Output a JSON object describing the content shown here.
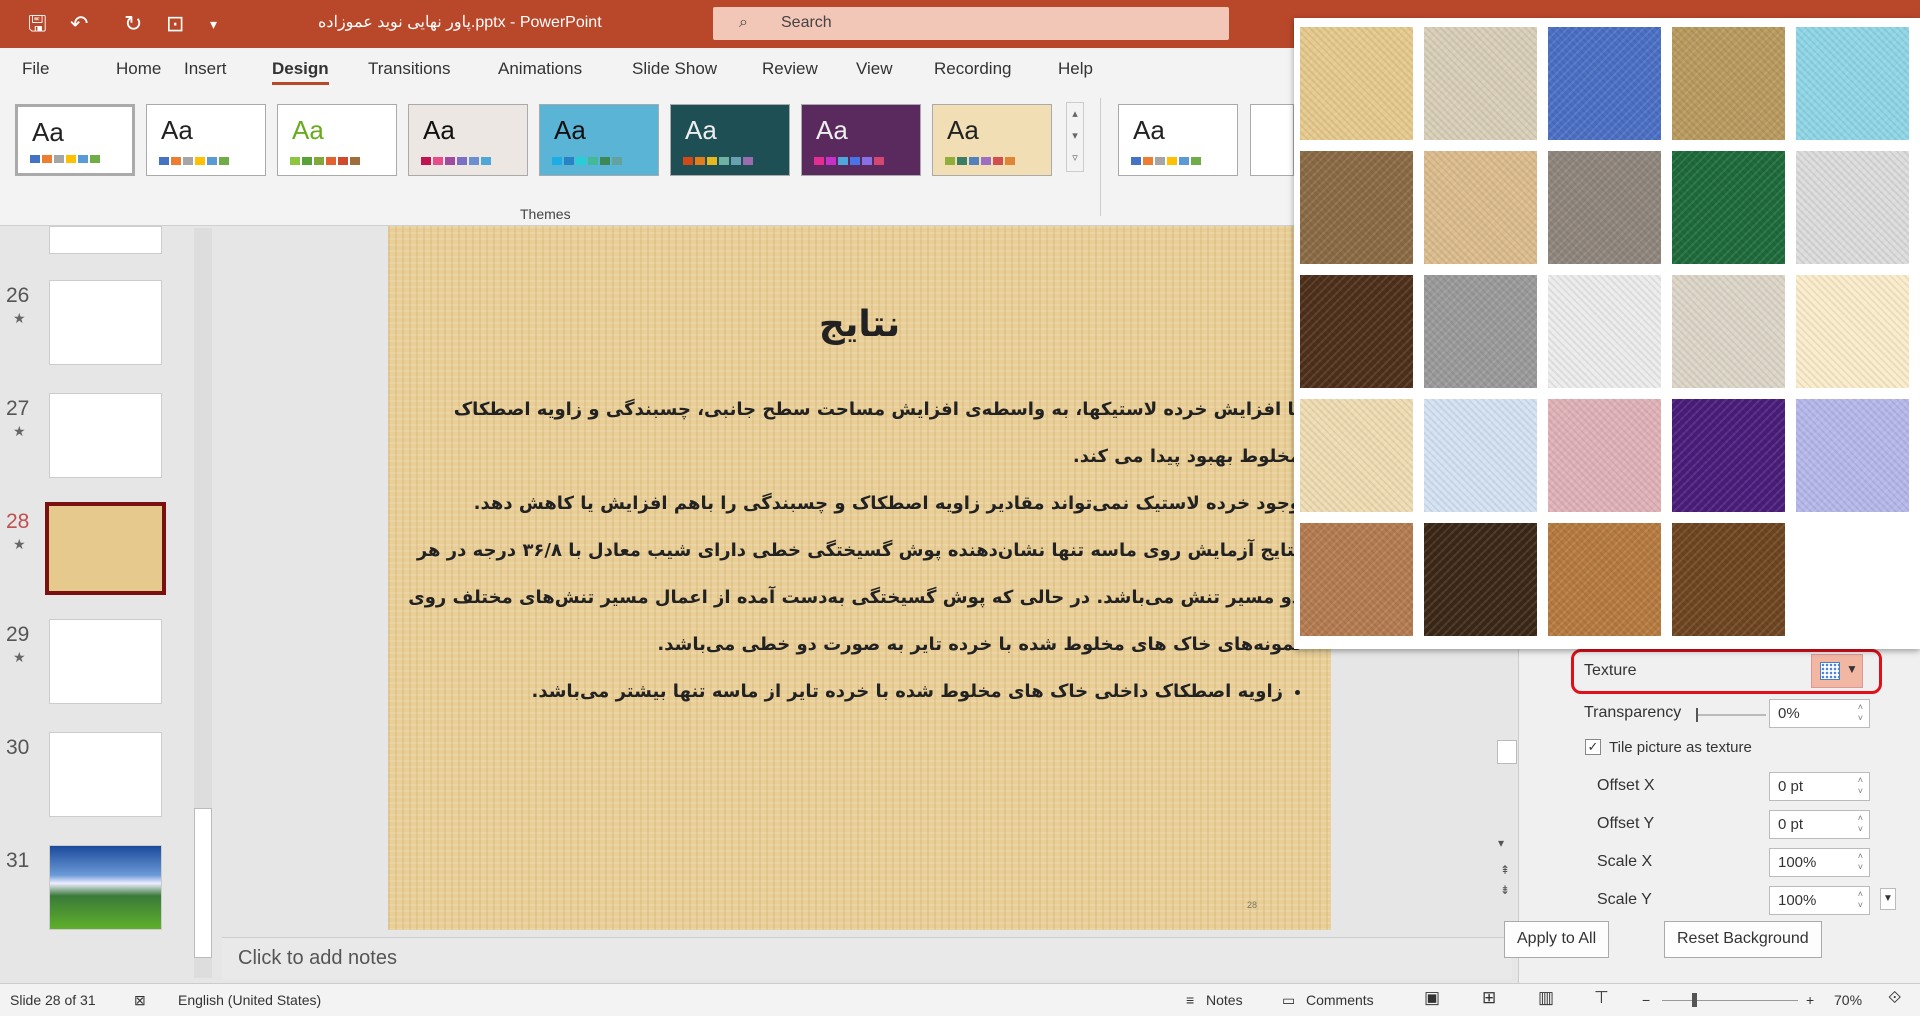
{
  "titlebar": {
    "file_title": "پاور نهایی نوید عموزاده.pptx  -  PowerPoint",
    "search_placeholder": "Search",
    "color": "#b9472a"
  },
  "quick_access": [
    "save-icon",
    "undo-icon",
    "redo-icon",
    "start-from-beginning-icon",
    "customize-icon"
  ],
  "tabs": [
    "File",
    "Home",
    "Insert",
    "Design",
    "Transitions",
    "Animations",
    "Slide Show",
    "Review",
    "View",
    "Recording",
    "Help"
  ],
  "active_tab": "Design",
  "ribbon": {
    "group_label": "Themes",
    "aa": "Aa",
    "themes": [
      {
        "bg": "#ffffff",
        "fg": "#222",
        "sw": [
          "#4472c4",
          "#ed7d31",
          "#a5a5a5",
          "#ffc000",
          "#5b9bd5",
          "#70ad47"
        ]
      },
      {
        "bg": "#ffffff",
        "fg": "#222",
        "sw": [
          "#4472c4",
          "#ed7d31",
          "#a5a5a5",
          "#ffc000",
          "#5b9bd5",
          "#70ad47"
        ]
      },
      {
        "bg": "#ffffff",
        "fg": "#6aab1e",
        "sw": [
          "#8cc63f",
          "#58a23a",
          "#80a83a",
          "#e2612f",
          "#d04b2e",
          "#9e6e3b"
        ]
      },
      {
        "bg": "#ece7e3",
        "fg": "#111",
        "sw": [
          "#c0134f",
          "#e84c8b",
          "#a04ba0",
          "#7a6fc5",
          "#6a8fd1",
          "#4fa7d9"
        ]
      },
      {
        "bg": "#5ab4d6",
        "fg": "#111",
        "sw": [
          "#1cade4",
          "#2683c6",
          "#27ced7",
          "#42ba97",
          "#3e8853",
          "#62a39f"
        ]
      },
      {
        "bg": "#1d4f55",
        "fg": "#eee",
        "sw": [
          "#d34817",
          "#e27d1e",
          "#e5b720",
          "#6fb1a2",
          "#68a0b1",
          "#9b6bb0"
        ]
      },
      {
        "bg": "#5a2a5e",
        "fg": "#eee",
        "sw": [
          "#e32d91",
          "#c830cc",
          "#4ea6dc",
          "#4775e7",
          "#8971e1",
          "#d54773"
        ]
      },
      {
        "bg": "#f1deb4",
        "fg": "#222",
        "sw": [
          "#92ae3a",
          "#3c7d66",
          "#5181bd",
          "#9c6fc0",
          "#d34f4f",
          "#e08538"
        ]
      },
      {
        "bg": "#ffffff",
        "fg": "#222",
        "sw": [
          "#4472c4",
          "#ed7d31",
          "#a5a5a5",
          "#ffc000",
          "#5b9bd5",
          "#70ad47"
        ]
      }
    ]
  },
  "slides_panel": {
    "items": [
      {
        "num": "26",
        "star": "★"
      },
      {
        "num": "27",
        "star": "★"
      },
      {
        "num": "28",
        "star": "★",
        "selected": true
      },
      {
        "num": "29",
        "star": "★"
      },
      {
        "num": "30"
      },
      {
        "num": "31"
      }
    ]
  },
  "slide": {
    "title": "نتایج",
    "paragraphs": [
      "با افزایش خرده لاستیکها، به واسطه‌ی افزایش مساحت سطح جانبی، چسبندگی و زاویه اصطکاک مخلوط بهبود پیدا می کند.",
      "وجود خرده لاستیک نمی‌تواند مقادیر زاویه اصطکاک و چسبندگی را باهم افزایش یا کاهش دهد.",
      "نتایج آزمایش روی ماسه تنها نشان‌دهنده پوش گسیختگی خطی دارای شیب معادل با ۳۶/۸ درجه در هر دو مسیر تنش می‌باشد. در حالی که پوش گسیختگی به‌دست آمده از اعمال مسیر تنش‌های مختلف روی نمونه‌های خاک های مخلوط شده با خرده تایر به صورت دو خطی می‌باشد."
    ],
    "bullet": "زاویه اصطکاک داخلی خاک های مخلوط شده با خرده تایر از ماسه تنها بیشتر می‌باشد.",
    "page_number": "28"
  },
  "notes_placeholder": "Click to add notes",
  "texture_gallery": [
    "#e6c98c",
    "#d9cfb8",
    "#4a6fc4",
    "#b99a5e",
    "#8fd6e6",
    "#8a6a44",
    "#dcbc8c",
    "#8f857c",
    "#1d6a3a",
    "#dcdcdc",
    "#4e2f1a",
    "#9a9a9a",
    "#ececec",
    "#ddd6c8",
    "#fbeccb",
    "#efdcb2",
    "#d4e2f2",
    "#e0b2b8",
    "#4a1c7a",
    "#b5b8ea",
    "#b37b4f",
    "#3b2716",
    "#b67a3f",
    "#6e4520"
  ],
  "format_panel": {
    "texture_label": "Texture",
    "transparency_label": "Transparency",
    "transparency_value": "0%",
    "transparency_level": 0,
    "tile_label": "Tile picture as texture",
    "tile_checked": true,
    "offset_x_label": "Offset X",
    "offset_x": "0 pt",
    "offset_y_label": "Offset Y",
    "offset_y": "0 pt",
    "scale_x_label": "Scale X",
    "scale_x": "100%",
    "scale_y_label": "Scale Y",
    "scale_y": "100%",
    "apply_all": "Apply to All",
    "reset": "Reset Background",
    "highlight_color": "#e0101a"
  },
  "status": {
    "slide_info": "Slide 28 of 31",
    "language": "English (United States)",
    "notes": "Notes",
    "comments": "Comments",
    "zoom": "70%",
    "zoom_level": 70
  }
}
